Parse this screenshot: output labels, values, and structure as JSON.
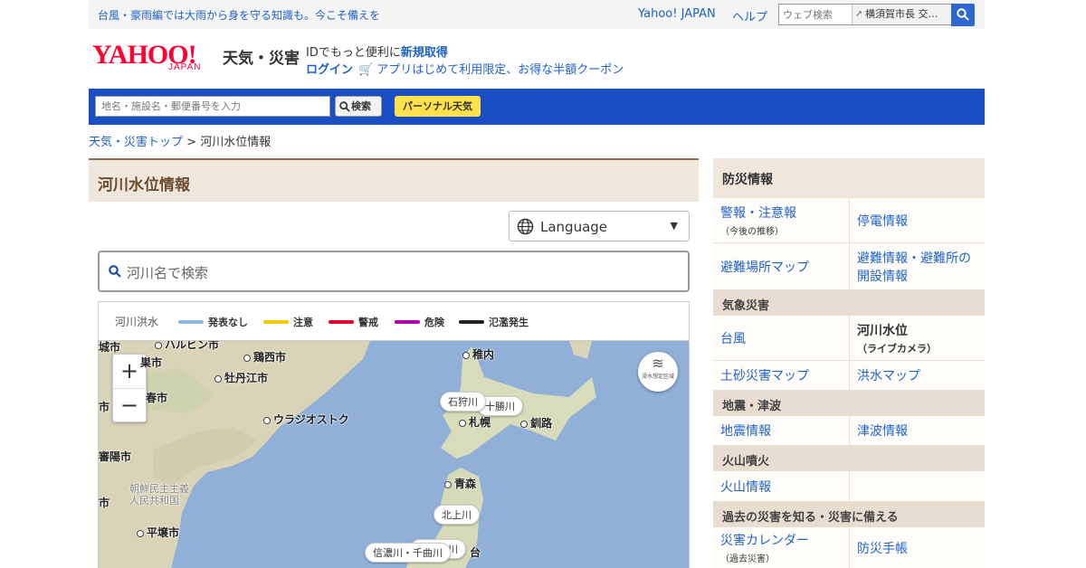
{
  "topbar": {
    "notice": "台風・豪雨編では大雨から身を守る知識も。今こそ備えを",
    "yahoo_japan": "Yahoo! JAPAN",
    "help": "ヘルプ",
    "search_placeholder": "ウェブ検索",
    "search_suggest": "横須賀市長 交…"
  },
  "header": {
    "logo_text": "YAHOO!",
    "logo_sub": "JAPAN",
    "service_name": "天気・災害",
    "id_prefix": "IDでもっと便利に",
    "id_link": "新規取得",
    "login": "ログイン",
    "coupon": "アプリはじめて利用限定、お得な半額クーポン"
  },
  "band": {
    "location_placeholder": "地名・施設名・郵便番号を入力",
    "search_button": "検索",
    "personal_button": "パーソナル天気"
  },
  "breadcrumb": {
    "home": "天気・災害トップ",
    "sep": ">",
    "current": "河川水位情報"
  },
  "main": {
    "title": "河川水位情報",
    "language": "Language",
    "river_search_placeholder": "河川名で検索",
    "legend_title": "河川洪水",
    "legend": [
      {
        "label": "発表なし",
        "color": "#8fb8e6"
      },
      {
        "label": "注意",
        "color": "#f5c800"
      },
      {
        "label": "警戒",
        "color": "#e8002d"
      },
      {
        "label": "危険",
        "color": "#b000b0"
      },
      {
        "label": "氾濫発生",
        "color": "#222222"
      }
    ]
  },
  "map": {
    "zoom_in": "+",
    "zoom_out": "−",
    "flood_button": "浸水想定区域",
    "places": {
      "harbin": "ハルビン市",
      "jixi": "鶏西市",
      "mudanjiang": "牡丹江市",
      "changchun": "春市",
      "vladivostok": "ウラジオストク",
      "wakkanai": "稚内",
      "sapporo": "札幌",
      "kushiro": "釧路",
      "aomori": "青森",
      "pyongyang": "平壌市",
      "dprk": "朝鮮民主主義人民共和国",
      "city_left1": "城市",
      "city_left2": "巣市",
      "city_left3": "市",
      "city_left4": "審陽市",
      "city_left5": "市",
      "sendai": "台"
    },
    "rivers": {
      "ishikari": "石狩川",
      "tokachi": "十勝川",
      "kitakami": "北上川",
      "shinano": "信濃川・千曲川",
      "abukuma": "阿武隈川"
    }
  },
  "sidebar": {
    "title": "防災情報",
    "rows1": [
      {
        "left": "警報・注意報",
        "left_sub": "（今後の推移）",
        "right": "停電情報"
      },
      {
        "left": "避難場所マップ",
        "right": "避難情報・避難所の開設情報"
      }
    ],
    "sec_weather": "気象災害",
    "rows2": [
      {
        "left": "台風",
        "right": "河川水位",
        "right_sub": "（ライブカメラ）"
      },
      {
        "left": "土砂災害マップ",
        "right": "洪水マップ"
      }
    ],
    "sec_quake": "地震・津波",
    "rows3": [
      {
        "left": "地震情報",
        "right": "津波情報"
      }
    ],
    "sec_volcano": "火山噴火",
    "rows4": [
      {
        "left": "火山情報",
        "right": ""
      }
    ],
    "sec_past": "過去の災害を知る・災害に備える",
    "rows5": [
      {
        "left": "災害カレンダー",
        "left_sub": "（過去災害）",
        "right": "防災手帳"
      }
    ]
  }
}
